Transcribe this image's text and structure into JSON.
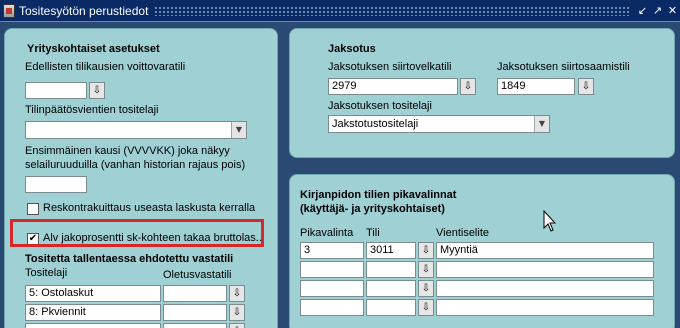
{
  "window": {
    "title": "Tositesyötön perustiedot",
    "controls": [
      "↙",
      "↗",
      "✕"
    ]
  },
  "left_panel": {
    "heading": "Yrityskohtaiset asetukset",
    "prev_account_label": "Edellisten tilikausien voittovaratili",
    "prev_account_value": "",
    "closing_doc_type_label": "Tilinpäätösvientien tositelaji",
    "closing_doc_type_value": "",
    "first_period_label_line1": "Ensimmäinen kausi (VVVVKK) joka näkyy",
    "first_period_label_line2": "selailuruuduilla (vanhan historian rajaus pois)",
    "first_period_value": "",
    "checkbox1_label": "Reskontrakuittaus useasta laskusta kerralla",
    "checkbox1_checked": false,
    "checkbox2_label": "Alv jakoprosentti sk-kohteen takaa bruttolas...",
    "checkbox2_checked": true,
    "suggested_heading": "Tositetta tallentaessa ehdotettu vastatili",
    "col_doc_type": "Tositelaji",
    "col_default_account": "Oletusvastatili",
    "rows": [
      {
        "doc_type": "5: Ostolaskut",
        "account": ""
      },
      {
        "doc_type": "8: Pkviennit",
        "account": ""
      }
    ]
  },
  "jaksotus": {
    "heading": "Jaksotus",
    "transfer_debt_label": "Jaksotuksen siirtovelkatili",
    "transfer_debt_value": "2979",
    "transfer_receivable_label": "Jaksotuksen siirtosaamistili",
    "transfer_receivable_value": "1849",
    "doc_type_label": "Jaksotuksen tositelaji",
    "doc_type_value": "Jakstotustositelaji"
  },
  "pikavalinnat": {
    "heading_line1": "Kirjanpidon tilien pikavalinnat",
    "heading_line2": "(käyttäjä- ja yrityskohtaiset)",
    "col_pika": "Pikavalinta",
    "col_tili": "Tili",
    "col_selite": "Vientiselite",
    "rows": [
      {
        "pika": "3",
        "tili": "3011",
        "selite": "Myyntiä"
      },
      {
        "pika": "",
        "tili": "",
        "selite": ""
      },
      {
        "pika": "",
        "tili": "",
        "selite": ""
      },
      {
        "pika": "",
        "tili": "",
        "selite": ""
      }
    ]
  },
  "icons": {
    "picker": "⇩",
    "dropdown": "▼",
    "check": "✔"
  }
}
